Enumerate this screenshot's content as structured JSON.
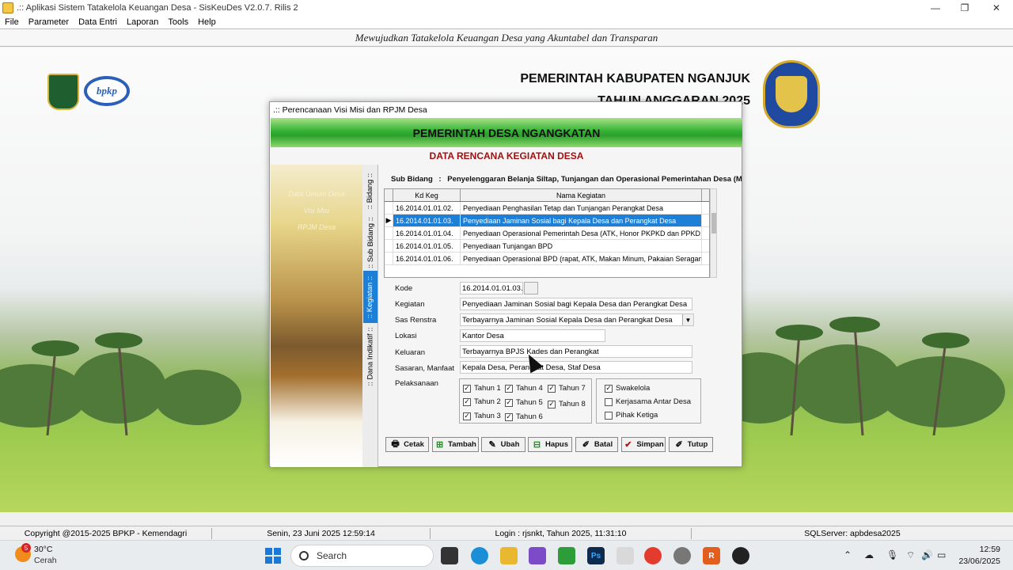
{
  "window": {
    "title": ".:: Aplikasi Sistem Tatakelola Keuangan Desa - SisKeuDes V2.0.7. Rilis 2",
    "minimize": "—",
    "maximize": "❐",
    "close": "✕"
  },
  "menu": [
    "File",
    "Parameter",
    "Data Entri",
    "Laporan",
    "Tools",
    "Help"
  ],
  "banner": "Mewujudkan Tatakelola Keuangan Desa yang Akuntabel dan Transparan",
  "header": {
    "pemkab": "PEMERINTAH KABUPATEN NGANJUK",
    "tahun": "TAHUN ANGGARAN 2025",
    "bpkp_logo": "bpkp"
  },
  "dialog": {
    "title": ".:: Perencanaan Visi Misi dan RPJM Desa",
    "header": "PEMERINTAH DESA NGANGKATAN",
    "subheader": "DATA RENCANA KEGIATAN DESA",
    "side_labels": [
      "Data Umum Desa",
      "Visi Misi",
      "RPJM Desa"
    ],
    "tabs": [
      ":: Bidang ::",
      ":: Sub Bidang ::",
      ":: Kegiatan ::",
      ":: Dana Indikatif ::"
    ],
    "sub_bidang_label": "Sub Bidang",
    "sub_bidang_sep": ":",
    "sub_bidang_value": "Penyelenggaran Belanja Siltap, Tunjangan dan Operasional Pemerintahan Desa (Ma",
    "grid": {
      "headers": [
        "Kd Keg",
        "Nama Kegiatan"
      ],
      "rows": [
        {
          "kd": "16.2014.01.01.02.",
          "nama": "Penyediaan Penghasilan Tetap dan Tunjangan Perangkat Desa"
        },
        {
          "kd": "16.2014.01.01.03.",
          "nama": "Penyediaan Jaminan Sosial bagi Kepala Desa dan Perangkat Desa"
        },
        {
          "kd": "16.2014.01.01.04.",
          "nama": "Penyediaan Operasional Pemerintah Desa (ATK, Honor PKPKD dan PPKD, Pe"
        },
        {
          "kd": "16.2014.01.01.05.",
          "nama": "Penyediaan Tunjangan BPD"
        },
        {
          "kd": "16.2014.01.01.06.",
          "nama": "Penyediaan Operasional BPD (rapat, ATK, Makan Minum, Pakaian Seragam,"
        }
      ],
      "row_marker": "▶"
    },
    "form": {
      "kode_label": "Kode",
      "kode": "16.2014.01.01.03.",
      "kegiatan_label": "Kegiatan",
      "kegiatan": "Penyediaan Jaminan Sosial bagi Kepala Desa dan Perangkat Desa",
      "sas_label": "Sas Renstra",
      "sas": "Terbayarnya Jaminan Sosial Kepala Desa dan Perangkat Desa",
      "sas_arrow": "▼",
      "lokasi_label": "Lokasi",
      "lokasi": "Kantor Desa",
      "keluaran_label": "Keluaran",
      "keluaran": "Terbayarnya BPJS Kades dan Perangkat",
      "sasaran_label": "Sasaran, Manfaat",
      "sasaran": "Kepala Desa, Perangkat Desa, Staf Desa",
      "pelaksanaan_label": "Pelaksanaan"
    },
    "check_mark": "✓",
    "tahun": [
      {
        "label": "Tahun 1",
        "checked": true
      },
      {
        "label": "Tahun 2",
        "checked": true
      },
      {
        "label": "Tahun 3",
        "checked": true
      },
      {
        "label": "Tahun 4",
        "checked": true
      },
      {
        "label": "Tahun 5",
        "checked": true
      },
      {
        "label": "Tahun 6",
        "checked": true
      },
      {
        "label": "Tahun 7",
        "checked": true
      },
      {
        "label": "Tahun 8",
        "checked": true
      }
    ],
    "pola": [
      {
        "label": "Swakelola",
        "checked": true
      },
      {
        "label": "Kerjasama Antar Desa",
        "checked": false
      },
      {
        "label": "Pihak Ketiga",
        "checked": false
      }
    ],
    "buttons": {
      "cetak": "Cetak",
      "tambah": "Tambah",
      "ubah": "Ubah",
      "hapus": "Hapus",
      "batal": "Batal",
      "simpan": "Simpan",
      "tutup": "Tutup"
    }
  },
  "status": {
    "copyright": "Copyright @2015-2025 BPKP - Kemendagri",
    "datetime": "Senin, 23 Juni 2025  12:59:14",
    "login": "Login : rjsnkt,  Tahun 2025, 11:31:10",
    "server": "SQLServer: apbdesa2025"
  },
  "taskbar": {
    "temp": "30°C",
    "condition": "Cerah",
    "weather_badge": "5",
    "search_placeholder": "Search",
    "ps_label": "Ps",
    "reader_label": "R",
    "time": "12:59",
    "date": "23/06/2025"
  }
}
